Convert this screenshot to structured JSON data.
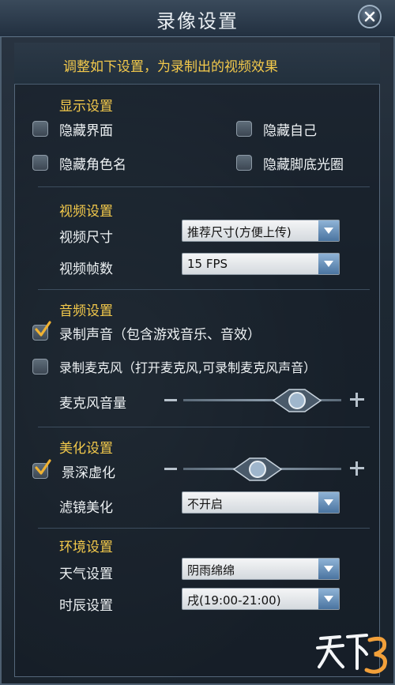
{
  "window": {
    "title": "录像设置"
  },
  "hint": "调整如下设置，为录制出的视频效果",
  "display": {
    "title": "显示设置",
    "items": [
      {
        "label": "隐藏界面",
        "checked": false
      },
      {
        "label": "隐藏自己",
        "checked": false
      },
      {
        "label": "隐藏角色名",
        "checked": false
      },
      {
        "label": "隐藏脚底光圈",
        "checked": false
      }
    ]
  },
  "video": {
    "title": "视频设置",
    "size_label": "视频尺寸",
    "size_value": "推荐尺寸(方便上传)",
    "fps_label": "视频帧数",
    "fps_value": "15 FPS"
  },
  "audio": {
    "title": "音频设置",
    "record_sound": {
      "label": "录制声音（包含游戏音乐、音效）",
      "checked": true
    },
    "record_mic": {
      "label": "录制麦克风（打开麦克风,可录制麦克风声音）",
      "checked": false
    },
    "mic_volume_label": "麦克风音量",
    "mic_volume_level": 0.72
  },
  "beauty": {
    "title": "美化设置",
    "dof": {
      "label": "景深虚化",
      "checked": true
    },
    "dof_level": 0.47,
    "filter_label": "滤镜美化",
    "filter_value": "不开启"
  },
  "environment": {
    "title": "环境设置",
    "weather_label": "天气设置",
    "weather_value": "阴雨绵绵",
    "time_label": "时辰设置",
    "time_value": "戌(19:00-21:00)"
  },
  "logo_text": "天下3",
  "colors": {
    "accent": "#f3c94b",
    "panel": "#1d2833",
    "text": "#eef2f4"
  }
}
